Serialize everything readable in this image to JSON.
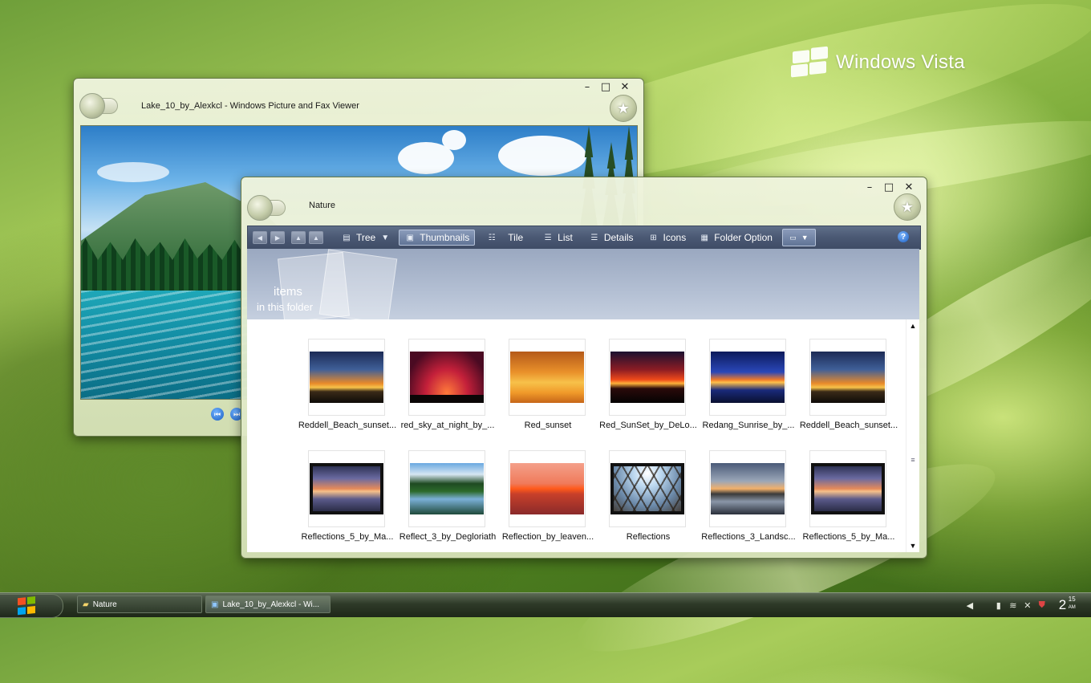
{
  "desktop": {
    "logo_text": "Windows Vista"
  },
  "viewer": {
    "title": "Lake_10_by_Alexkcl - Windows Picture and Fax Viewer",
    "controls": {
      "minimize": "–",
      "maximize": "□",
      "close": "✕"
    },
    "nav": {
      "prev": "⏮",
      "next": "⏭"
    }
  },
  "explorer": {
    "title": "Nature",
    "controls": {
      "minimize": "–",
      "maximize": "□",
      "close": "✕"
    },
    "toolbar": {
      "tree": "Tree",
      "thumbnails": "Thumbnails",
      "tile": "Tile",
      "list": "List",
      "details": "Details",
      "icons": "Icons",
      "folder_option": "Folder Option",
      "help": "?"
    },
    "header": {
      "items": "items",
      "sub": "in this folder"
    },
    "thumbnails": [
      {
        "caption": "Reddell_Beach_sunset...",
        "style": "sunset-a"
      },
      {
        "caption": "red_sky_at_night_by_...",
        "style": "sunset-b"
      },
      {
        "caption": "Red_sunset",
        "style": "sunset-c"
      },
      {
        "caption": "Red_SunSet_by_DeLo...",
        "style": "sunset-d"
      },
      {
        "caption": "Redang_Sunrise_by_...",
        "style": "sunset-e"
      },
      {
        "caption": "Reddell_Beach_sunset...",
        "style": "sunset-a"
      },
      {
        "caption": "Reflections_5_by_Ma...",
        "style": "refl-a"
      },
      {
        "caption": "Reflect_3_by_Degloriath",
        "style": "refl-b"
      },
      {
        "caption": "Reflection_by_leaven...",
        "style": "refl-c"
      },
      {
        "caption": "Reflections",
        "style": "refl-d"
      },
      {
        "caption": "Reflections_3_Landsc...",
        "style": "refl-e"
      },
      {
        "caption": "Reflections_5_by_Ma...",
        "style": "refl-a"
      }
    ]
  },
  "taskbar": {
    "buttons": [
      {
        "label": "Nature",
        "icon": "folder-icon"
      },
      {
        "label": "Lake_10_by_Alexkcl - Wi...",
        "icon": "picture-icon"
      }
    ],
    "clock": {
      "hour": "2",
      "minute": "15",
      "ampm": "AM"
    }
  }
}
